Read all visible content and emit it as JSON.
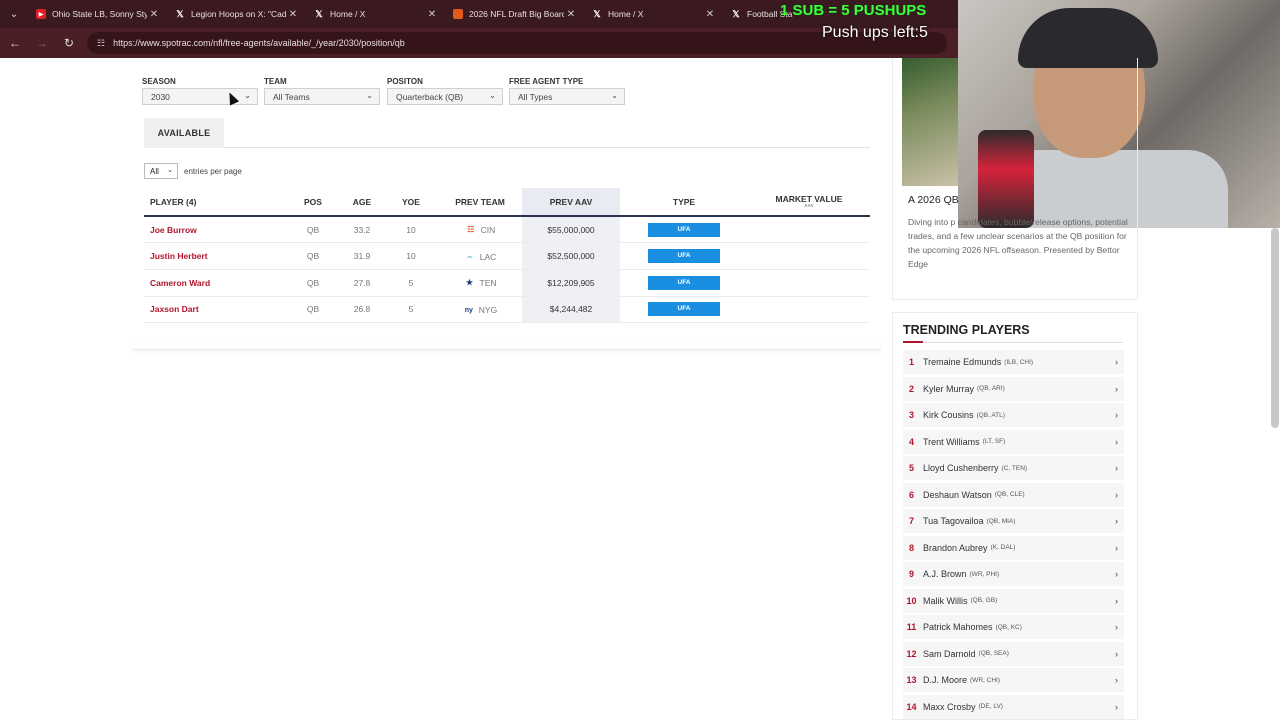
{
  "browser": {
    "tabs": [
      {
        "title": "Ohio State LB, Sonny Styles",
        "icon": "youtube-icon"
      },
      {
        "title": "Legion Hoops on X: \"Cade",
        "icon": "x-icon"
      },
      {
        "title": "Home / X",
        "icon": "x-icon"
      },
      {
        "title": "2026 NFL Draft Big Board",
        "icon": "draft-icon"
      },
      {
        "title": "Home / X",
        "icon": "x-icon"
      },
      {
        "title": "Football Sta",
        "icon": "x-icon"
      }
    ],
    "url": "https://www.spotrac.com/nfl/free-agents/available/_/year/2030/position/qb"
  },
  "overlay": {
    "sub_banner": "1 SUB = 5 PUSHUPS",
    "pushups_left": "Push ups left:5"
  },
  "filters": {
    "season": {
      "label": "SEASON",
      "value": "2030"
    },
    "team": {
      "label": "TEAM",
      "value": "All Teams"
    },
    "position": {
      "label": "POSITON",
      "value": "Quarterback (QB)"
    },
    "fa_type": {
      "label": "FREE AGENT TYPE",
      "value": "All Types"
    }
  },
  "tabs": {
    "available": "AVAILABLE"
  },
  "entries": {
    "value": "All",
    "text": "entries per page"
  },
  "table": {
    "headers": {
      "player": "PLAYER (4)",
      "pos": "POS",
      "age": "AGE",
      "yoe": "YOE",
      "prev_team": "PREV TEAM",
      "prev_aav": "PREV AAV",
      "type": "TYPE",
      "market_value": "MARKET VALUE",
      "market_value_sub": "AAV"
    },
    "rows": [
      {
        "player": "Joe Burrow",
        "pos": "QB",
        "age": "33.2",
        "yoe": "10",
        "team": "CIN",
        "aav": "$55,000,000",
        "type": "UFA"
      },
      {
        "player": "Justin Herbert",
        "pos": "QB",
        "age": "31.9",
        "yoe": "10",
        "team": "LAC",
        "aav": "$52,500,000",
        "type": "UFA"
      },
      {
        "player": "Cameron Ward",
        "pos": "QB",
        "age": "27.8",
        "yoe": "5",
        "team": "TEN",
        "aav": "$12,209,905",
        "type": "UFA"
      },
      {
        "player": "Jaxson Dart",
        "pos": "QB",
        "age": "26.8",
        "yoe": "5",
        "team": "NYG",
        "aav": "$4,244,482",
        "type": "UFA"
      }
    ]
  },
  "article": {
    "title": "A 2026 QB",
    "body": "Diving into p candidates, bubble/release options, potential trades, and a few unclear scenarios at the QB position for the upcoming 2026 NFL offseason. Presented by Bettor Edge"
  },
  "trending": {
    "title": "TRENDING PLAYERS",
    "players": [
      {
        "rank": "1",
        "name": "Tremaine Edmunds",
        "meta": "(ILB, CHI)"
      },
      {
        "rank": "2",
        "name": "Kyler Murray",
        "meta": "(QB, ARI)"
      },
      {
        "rank": "3",
        "name": "Kirk Cousins",
        "meta": "(QB, ATL)"
      },
      {
        "rank": "4",
        "name": "Trent Williams",
        "meta": "(LT, SF)"
      },
      {
        "rank": "5",
        "name": "Lloyd Cushenberry",
        "meta": "(C, TEN)"
      },
      {
        "rank": "6",
        "name": "Deshaun Watson",
        "meta": "(QB, CLE)"
      },
      {
        "rank": "7",
        "name": "Tua Tagovailoa",
        "meta": "(QB, MIA)"
      },
      {
        "rank": "8",
        "name": "Brandon Aubrey",
        "meta": "(K, DAL)"
      },
      {
        "rank": "9",
        "name": "A.J. Brown",
        "meta": "(WR, PHI)"
      },
      {
        "rank": "10",
        "name": "Malik Willis",
        "meta": "(QB, GB)"
      },
      {
        "rank": "11",
        "name": "Patrick Mahomes",
        "meta": "(QB, KC)"
      },
      {
        "rank": "12",
        "name": "Sam Darnold",
        "meta": "(QB, SEA)"
      },
      {
        "rank": "13",
        "name": "D.J. Moore",
        "meta": "(WR, CHI)"
      },
      {
        "rank": "14",
        "name": "Maxx Crosby",
        "meta": "(DE, LV)"
      }
    ]
  },
  "colors": {
    "accent_red": "#b0152c",
    "ufa_blue": "#1a8ee0",
    "browser_dark": "#3a1a20",
    "banner_green": "#3cff3c"
  }
}
